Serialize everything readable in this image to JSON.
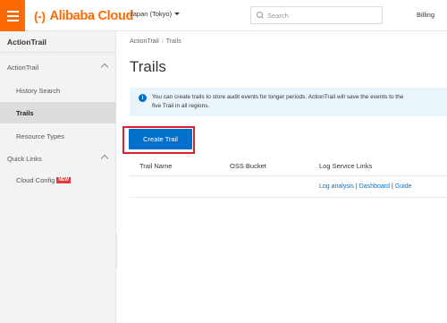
{
  "topbar": {
    "logo_mark": "(-)",
    "logo_text": "Alibaba Cloud",
    "region": "Japan (Tokyo)",
    "search_placeholder": "Search",
    "billing": "Billing"
  },
  "sidebar": {
    "title": "ActionTrail",
    "groups": [
      {
        "label": "ActionTrail",
        "items": [
          "History Search",
          "Trails",
          "Resource Types"
        ]
      },
      {
        "label": "Quick Links",
        "items": [
          "Cloud Config"
        ]
      }
    ],
    "active_item": "Trails",
    "new_badge": "NEW"
  },
  "main": {
    "breadcrumb": [
      "ActionTrail",
      "Trails"
    ],
    "breadcrumb_sep": "/",
    "title": "Trails",
    "notice_line1": "You can create trails to store audit events for longer periods. ActionTrail will save the events to the",
    "notice_line2": "five Trail in all regions.",
    "create_button": "Create Trail",
    "table": {
      "columns": [
        "Trail Name",
        "OSS Bucket",
        "Log Service Links"
      ],
      "row_links": [
        "Log analysis",
        "Dashboard",
        "Guide"
      ]
    }
  },
  "colors": {
    "brand_orange": "#ff6a00",
    "primary_blue": "#0070cc",
    "highlight_red": "#d9222a",
    "notice_bg": "#eaf4fb"
  },
  "icons": [
    "menu-icon",
    "caret-down-icon",
    "search-icon",
    "chevron-up-icon",
    "chevron-left-icon",
    "info-icon"
  ]
}
